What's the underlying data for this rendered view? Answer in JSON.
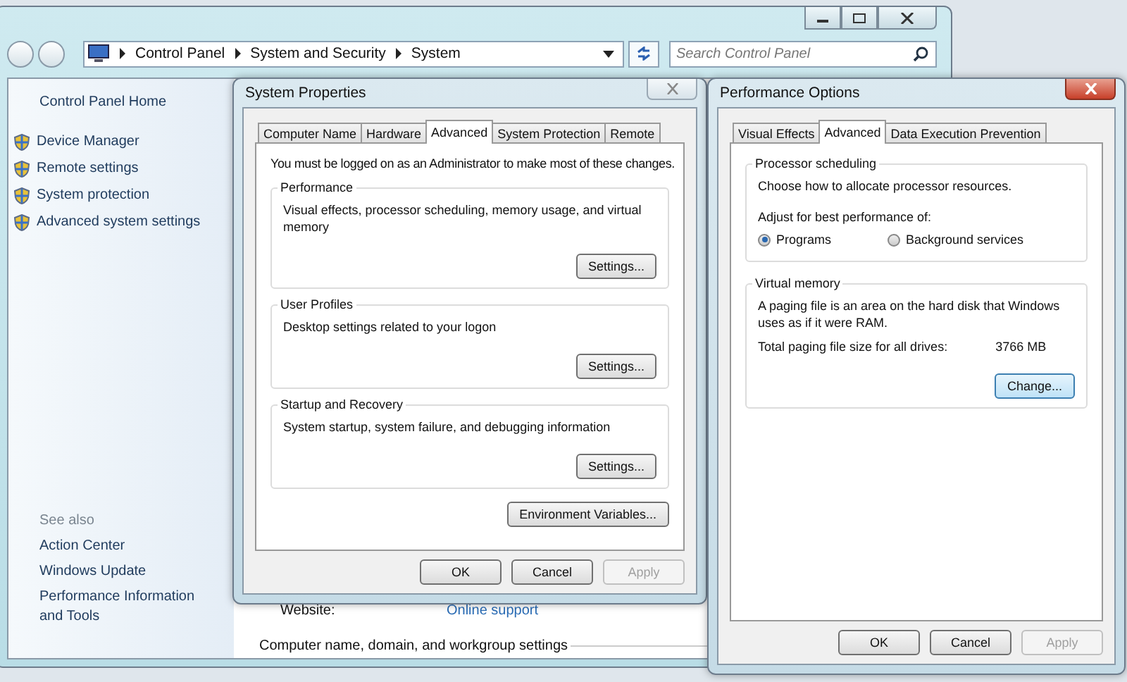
{
  "control_panel": {
    "breadcrumb": [
      "Control Panel",
      "System and Security",
      "System"
    ],
    "search": {
      "placeholder": "Search Control Panel"
    },
    "sidebar": {
      "home": "Control Panel Home",
      "tasks": [
        "Device Manager",
        "Remote settings",
        "System protection",
        "Advanced system settings"
      ],
      "see_also_heading": "See also",
      "see_also": [
        "Action Center",
        "Windows Update",
        "Performance Information and Tools"
      ]
    },
    "content": {
      "website_label": "Website:",
      "website_link": "Online support",
      "section_heading": "Computer name, domain, and workgroup settings"
    }
  },
  "system_properties": {
    "title": "System Properties",
    "tabs": [
      {
        "label": "Computer Name",
        "selected": false
      },
      {
        "label": "Hardware",
        "selected": false
      },
      {
        "label": "Advanced",
        "selected": true
      },
      {
        "label": "System Protection",
        "selected": false
      },
      {
        "label": "Remote",
        "selected": false
      }
    ],
    "notice": "You must be logged on as an Administrator to make most of these changes.",
    "groups": [
      {
        "title": "Performance",
        "description": "Visual effects, processor scheduling, memory usage, and virtual memory",
        "button": "Settings..."
      },
      {
        "title": "User Profiles",
        "description": "Desktop settings related to your logon",
        "button": "Settings..."
      },
      {
        "title": "Startup and Recovery",
        "description": "System startup, system failure, and debugging information",
        "button": "Settings..."
      }
    ],
    "env_button": "Environment Variables...",
    "buttons": [
      {
        "label": "OK",
        "disabled": false
      },
      {
        "label": "Cancel",
        "disabled": false
      },
      {
        "label": "Apply",
        "disabled": true
      }
    ]
  },
  "performance_options": {
    "title": "Performance Options",
    "tabs": [
      {
        "label": "Visual Effects",
        "selected": false
      },
      {
        "label": "Advanced",
        "selected": true
      },
      {
        "label": "Data Execution Prevention",
        "selected": false
      }
    ],
    "processor": {
      "title": "Processor scheduling",
      "description": "Choose how to allocate processor resources.",
      "prompt": "Adjust for best performance of:",
      "options": [
        {
          "label": "Programs",
          "selected": true
        },
        {
          "label": "Background services",
          "selected": false
        }
      ]
    },
    "virtual_memory": {
      "title": "Virtual memory",
      "description": "A paging file is an area on the hard disk that Windows uses as if it were RAM.",
      "total_label": "Total paging file size for all drives:",
      "total_value": "3766 MB",
      "button": "Change..."
    },
    "buttons": [
      {
        "label": "OK",
        "disabled": false
      },
      {
        "label": "Cancel",
        "disabled": false
      },
      {
        "label": "Apply",
        "disabled": true
      }
    ]
  }
}
